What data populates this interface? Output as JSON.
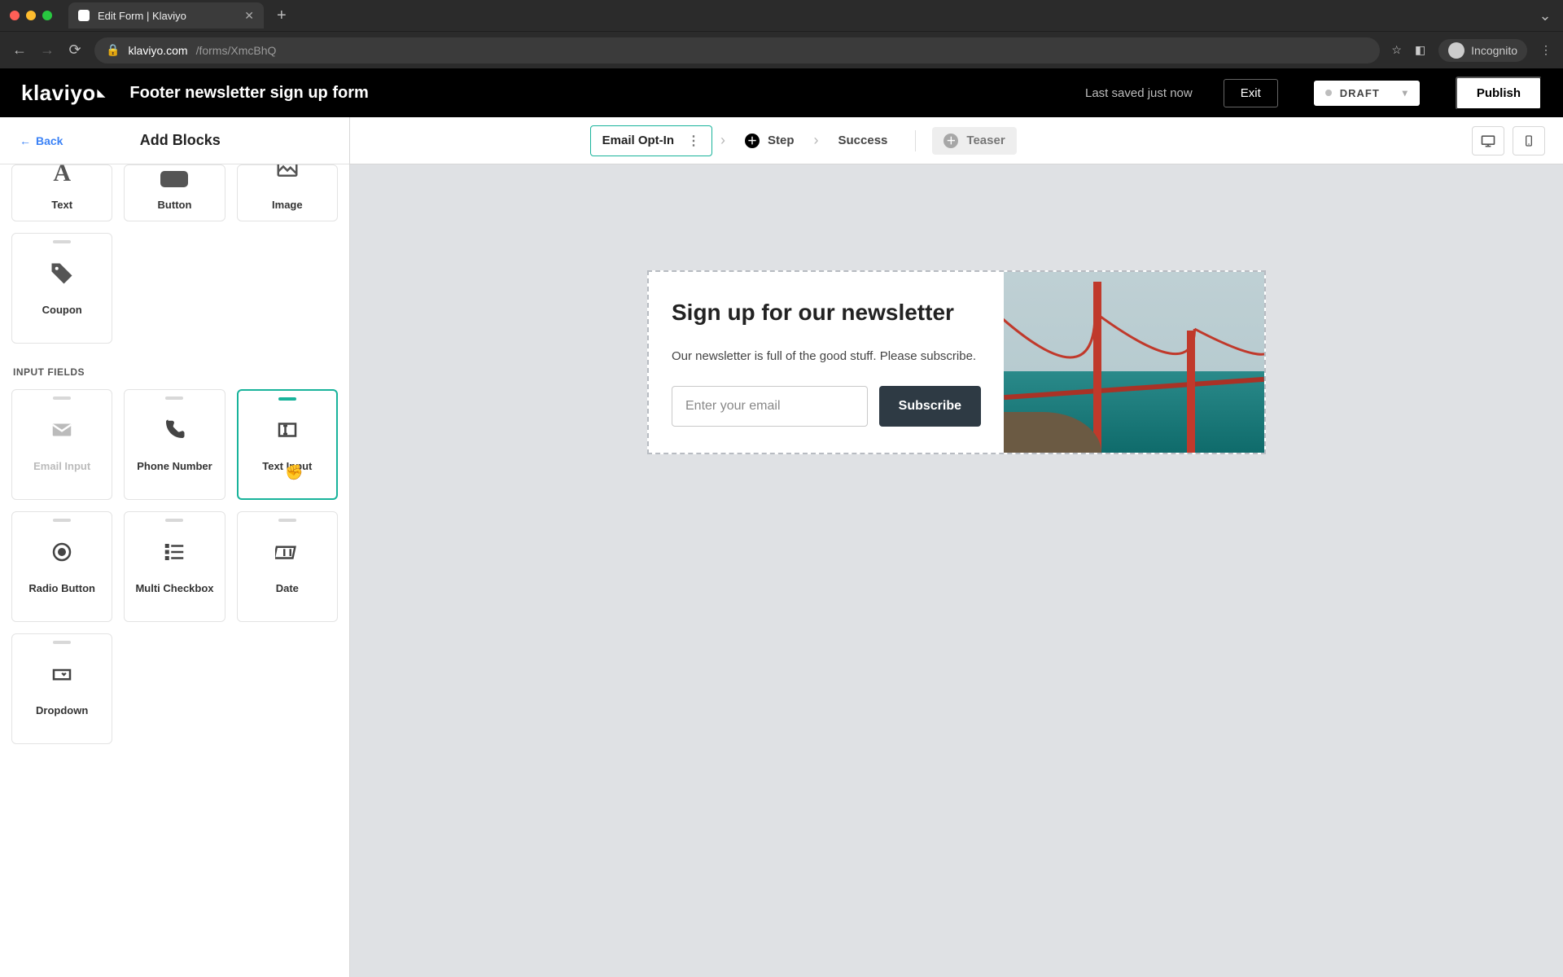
{
  "browser": {
    "tab_title": "Edit Form | Klaviyo",
    "url_host": "klaviyo.com",
    "url_path": "/forms/XmcBhQ",
    "incognito_label": "Incognito"
  },
  "app_bar": {
    "brand": "klaviyo",
    "form_title": "Footer newsletter sign up form",
    "last_saved": "Last saved just now",
    "exit_label": "Exit",
    "status_label": "DRAFT",
    "publish_label": "Publish"
  },
  "sidebar": {
    "back_label": "Back",
    "title": "Add Blocks",
    "section_input_fields": "INPUT FIELDS",
    "blocks": {
      "text": "Text",
      "button": "Button",
      "image": "Image",
      "coupon": "Coupon",
      "email_input": "Email Input",
      "phone_number": "Phone Number",
      "text_input": "Text Input",
      "radio_button": "Radio Button",
      "multi_checkbox": "Multi Checkbox",
      "date": "Date",
      "dropdown": "Dropdown"
    }
  },
  "toolbar": {
    "step_email_optin": "Email Opt-In",
    "step_add": "Step",
    "step_success": "Success",
    "step_teaser": "Teaser"
  },
  "preview_form": {
    "heading": "Sign up for our newsletter",
    "paragraph": "Our newsletter is full of the good stuff. Please subscribe.",
    "email_placeholder": "Enter your email",
    "submit_label": "Subscribe"
  }
}
